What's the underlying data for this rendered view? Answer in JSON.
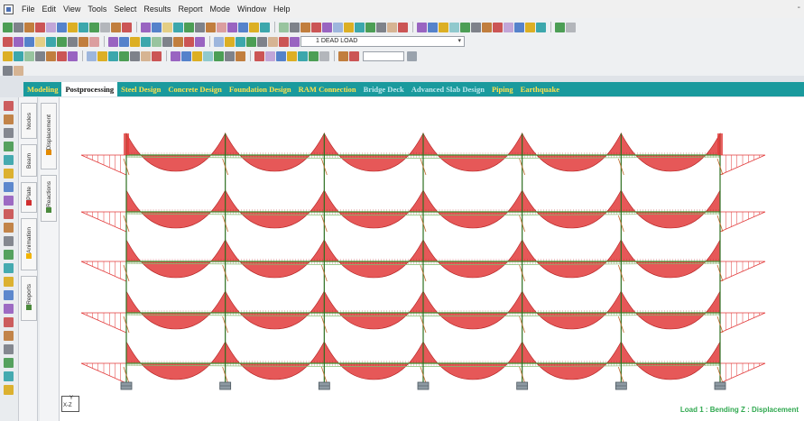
{
  "menu": {
    "items": [
      "File",
      "Edit",
      "View",
      "Tools",
      "Select",
      "Results",
      "Report",
      "Mode",
      "Window",
      "Help"
    ],
    "window_control": "-"
  },
  "toolbar": {
    "load_case": "1 DEAD LOAD",
    "combo_icon": "load-case-icon"
  },
  "modes": {
    "tabs": [
      "Modeling",
      "Postprocessing",
      "Steel Design",
      "Concrete Design",
      "Foundation Design",
      "RAM Connection",
      "Bridge Deck",
      "Advanced Slab Design",
      "Piping",
      "Earthquake"
    ],
    "active": "Postprocessing",
    "dimmed": [
      "Bridge Deck",
      "Advanced Slab Design"
    ]
  },
  "left_panel": {
    "tabs_outer": [
      {
        "label": "Nodes",
        "marker_color": "#2f6fd1"
      },
      {
        "label": "Beam",
        "marker_color": "#d12f2f"
      },
      {
        "label": "Plate",
        "marker_color": "#d12f2f"
      },
      {
        "label": "Animation",
        "marker_color": "#f2b400"
      },
      {
        "label": "Reports",
        "marker_color": "#4b8a3c"
      }
    ],
    "tabs_inner": [
      {
        "label": "Displacement",
        "marker_color": "#e28a00"
      },
      {
        "label": "Reactions",
        "marker_color": "#4b8a3c"
      }
    ]
  },
  "viewport": {
    "axis_labels": {
      "y": "Y",
      "xz": "X-Z"
    },
    "status_text": "Load 1 : Bending Z : Displacement",
    "colors": {
      "moment_fill": "#e23b3b",
      "beam_line": "#3f8f2f",
      "column_line": "#2c6f1f",
      "support_fill": "#8e9aa3"
    },
    "structure": {
      "bays": 6,
      "floors": 5
    }
  }
}
